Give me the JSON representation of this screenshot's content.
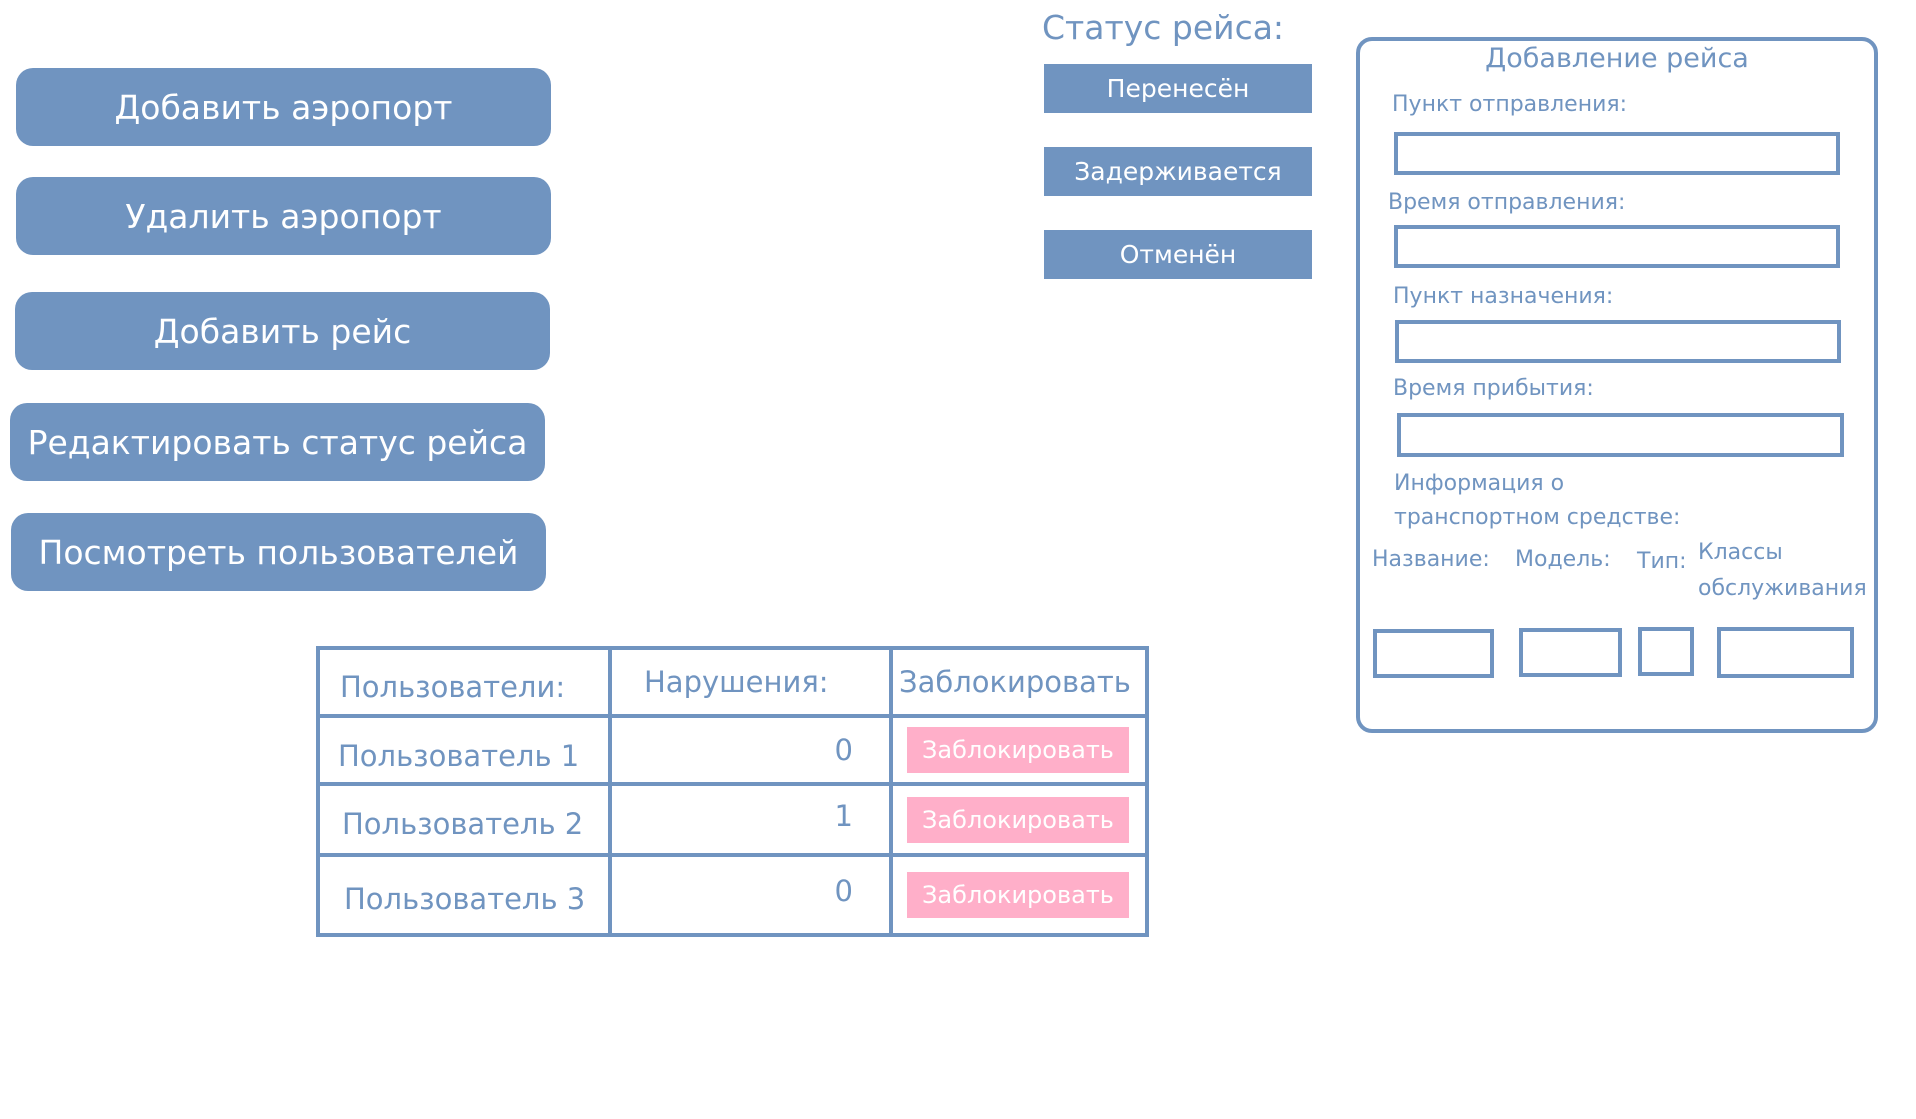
{
  "menu": [
    "Добавить аэропорт",
    "Удалить аэропорт",
    "Добавить рейс",
    "Редактировать статус рейса",
    "Посмотреть пользователей"
  ],
  "status": {
    "title": "Статус рейса:",
    "options": [
      "Перенесён",
      "Задерживается",
      "Отменён"
    ]
  },
  "form": {
    "title": "Добавление рейса",
    "departure_point": "Пункт отправления:",
    "departure_time": "Время отправления:",
    "destination": "Пункт назначения:",
    "arrival_time": "Время прибытия:",
    "vehicle_info_1": "Информация о",
    "vehicle_info_2": "транспортном средстве:",
    "name": "Название:",
    "model": "Модель:",
    "type": "Тип:",
    "classes_1": "Классы",
    "classes_2": "обслуживания"
  },
  "table": {
    "headers": [
      "Пользователи:",
      "Нарушения:",
      "Заблокировать"
    ],
    "rows": [
      {
        "user": "Пользователь 1",
        "violations": "0",
        "action": "Заблокировать"
      },
      {
        "user": "Пользователь 2",
        "violations": "1",
        "action": "Заблокировать"
      },
      {
        "user": "Пользователь 3",
        "violations": "0",
        "action": "Заблокировать"
      }
    ]
  },
  "colors": {
    "accent": "#7094c0",
    "block": "#ffafc9"
  }
}
